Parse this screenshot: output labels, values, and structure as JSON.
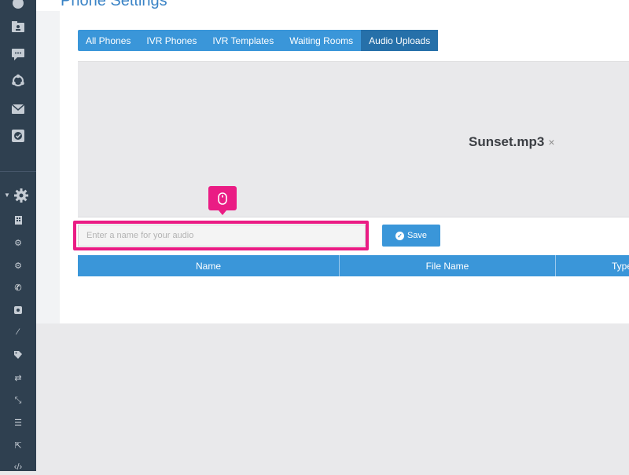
{
  "page": {
    "title": "Phone Settings"
  },
  "tabs": [
    {
      "label": "All Phones"
    },
    {
      "label": "IVR Phones"
    },
    {
      "label": "IVR Templates"
    },
    {
      "label": "Waiting Rooms"
    },
    {
      "label": "Audio Uploads",
      "active": true
    }
  ],
  "upload": {
    "file_name": "Sunset.mp3",
    "remove_symbol": "×"
  },
  "audio_name": {
    "value": "",
    "placeholder": "Enter a name for your audio"
  },
  "save_button": {
    "label": "Save"
  },
  "table": {
    "columns": [
      "Name",
      "File Name",
      "Type"
    ]
  },
  "sidebar": {
    "top_icons": [
      "user-icon",
      "folder-user-icon",
      "chat-icon",
      "network-icon",
      "mail-icon",
      "check-square-icon"
    ],
    "settings_icons": [
      "settings-gear-icon",
      "building-icon",
      "gear-icon",
      "gears-icon",
      "phone-icon",
      "phone-square-icon",
      "magic-wand-icon",
      "tag-icon",
      "exchange-icon",
      "compress-icon",
      "sliders-icon",
      "share-icon",
      "code-icon"
    ]
  },
  "colors": {
    "sidebar": "#2f4050",
    "accent": "#3a96d9",
    "active_tab": "#2670a9",
    "highlight": "#ea1c84"
  }
}
